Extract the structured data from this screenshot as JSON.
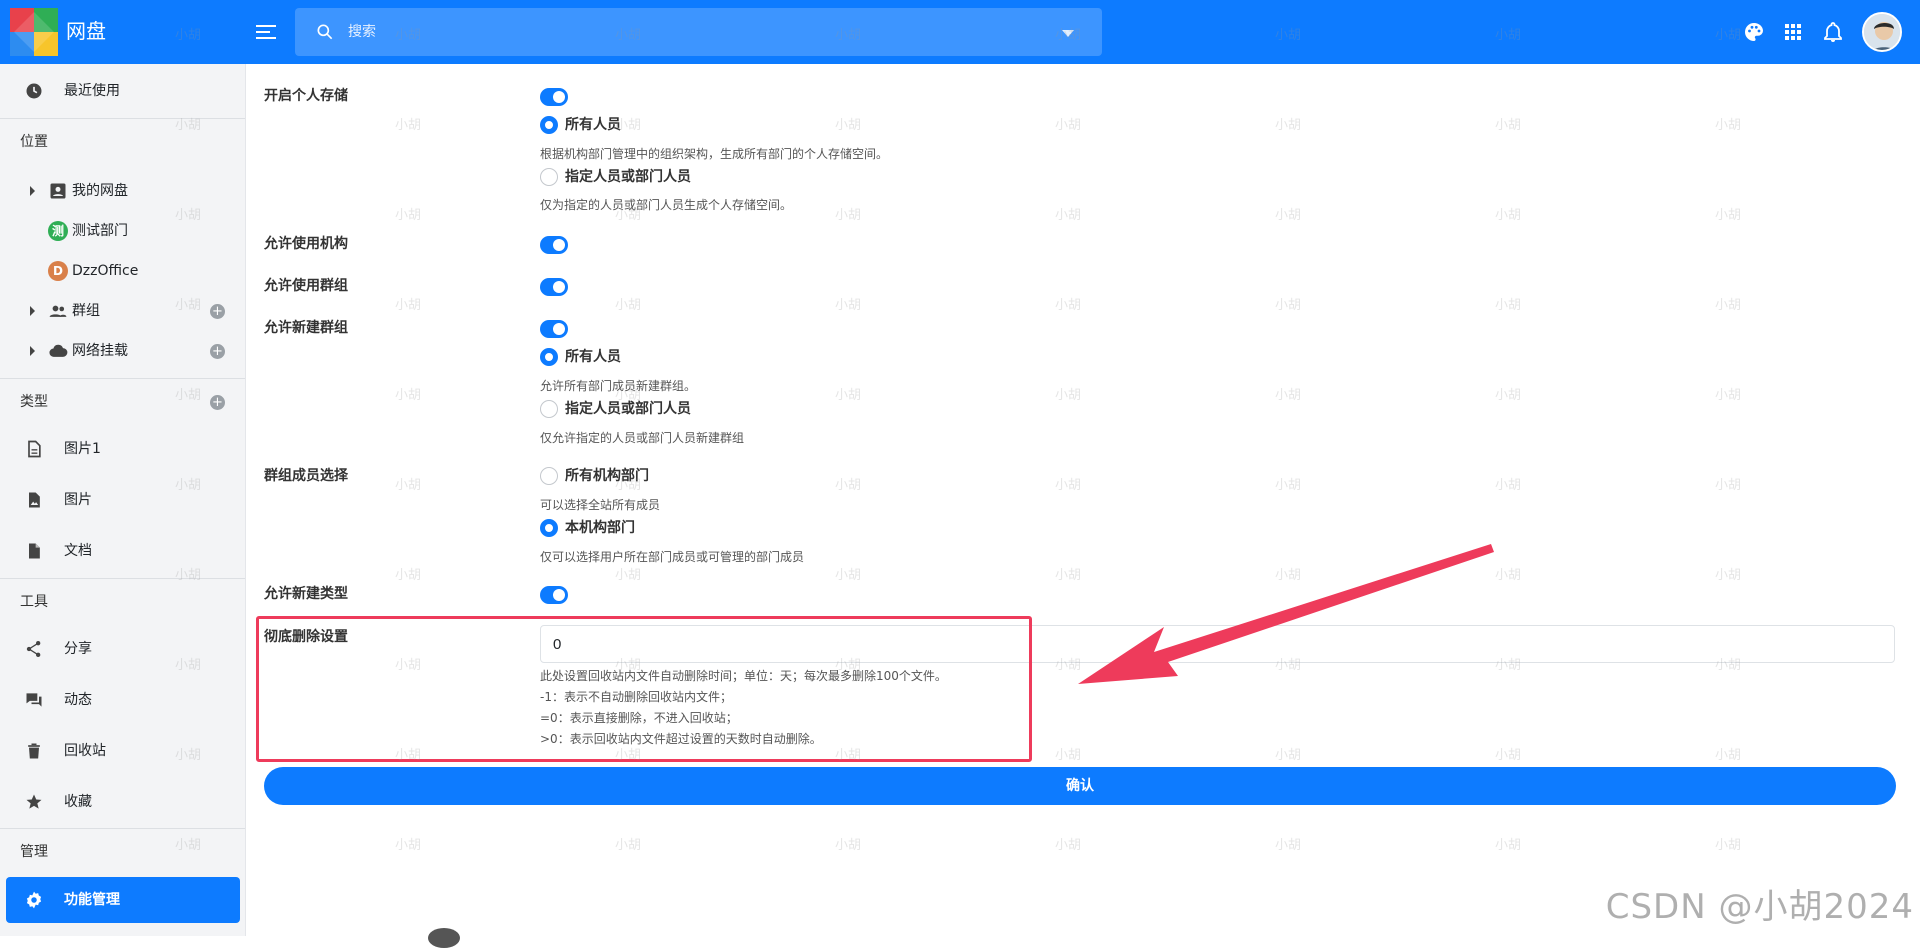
{
  "topbar": {
    "app_title": "网盘",
    "search_placeholder": "搜索",
    "icons": [
      "menu-icon",
      "search-icon",
      "palette-icon",
      "apps-grid-icon",
      "bell-icon"
    ]
  },
  "sidebar": {
    "recent": "最近使用",
    "section_location": "位置",
    "my_drive": "我的网盘",
    "test_dept": "测试部门",
    "test_dept_badge": "测",
    "dzzoffice": "DzzOffice",
    "dzzoffice_badge": "D",
    "groups": "群组",
    "network_mount": "网络挂载",
    "section_types": "类型",
    "types": [
      "图片1",
      "图片",
      "文档"
    ],
    "section_tools": "工具",
    "tools": [
      "分享",
      "动态",
      "回收站",
      "收藏"
    ],
    "section_admin": "管理",
    "feature_management": "功能管理",
    "add_symbol": "+"
  },
  "form": {
    "personal_storage": {
      "label": "开启个人存储",
      "opt_all": "所有人员",
      "opt_all_hint": "根据机构部门管理中的组织架构，生成所有部门的个人存储空间。",
      "opt_specific": "指定人员或部门人员",
      "opt_specific_hint": "仅为指定的人员或部门人员生成个人存储空间。"
    },
    "allow_org": {
      "label": "允许使用机构"
    },
    "allow_group": {
      "label": "允许使用群组"
    },
    "allow_new_group": {
      "label": "允许新建群组",
      "opt_all": "所有人员",
      "opt_all_hint": "允许所有部门成员新建群组。",
      "opt_specific": "指定人员或部门人员",
      "opt_specific_hint": "仅允许指定的人员或部门人员新建群组"
    },
    "group_member_select": {
      "label": "群组成员选择",
      "opt_all_org": "所有机构部门",
      "opt_all_org_hint": "可以选择全站所有成员",
      "opt_own_org": "本机构部门",
      "opt_own_org_hint": "仅可以选择用户所在部门成员或可管理的部门成员"
    },
    "allow_new_type": {
      "label": "允许新建类型"
    },
    "purge_setting": {
      "label": "彻底删除设置",
      "value": "0",
      "hint1": "此处设置回收站内文件自动删除时间；单位：天；每次最多删除100个文件。",
      "hint2": "-1：表示不自动删除回收站内文件；",
      "hint3": "=0：表示直接删除，不进入回收站；",
      "hint4": ">0：表示回收站内文件超过设置的天数时自动删除。"
    },
    "submit_label": "确认"
  },
  "watermark": {
    "text": "小胡",
    "credit": "CSDN @小胡2024"
  },
  "colors": {
    "primary": "#0d7bff",
    "sidebar_bg": "#f3f4f6",
    "highlight": "#ee3b5b"
  }
}
